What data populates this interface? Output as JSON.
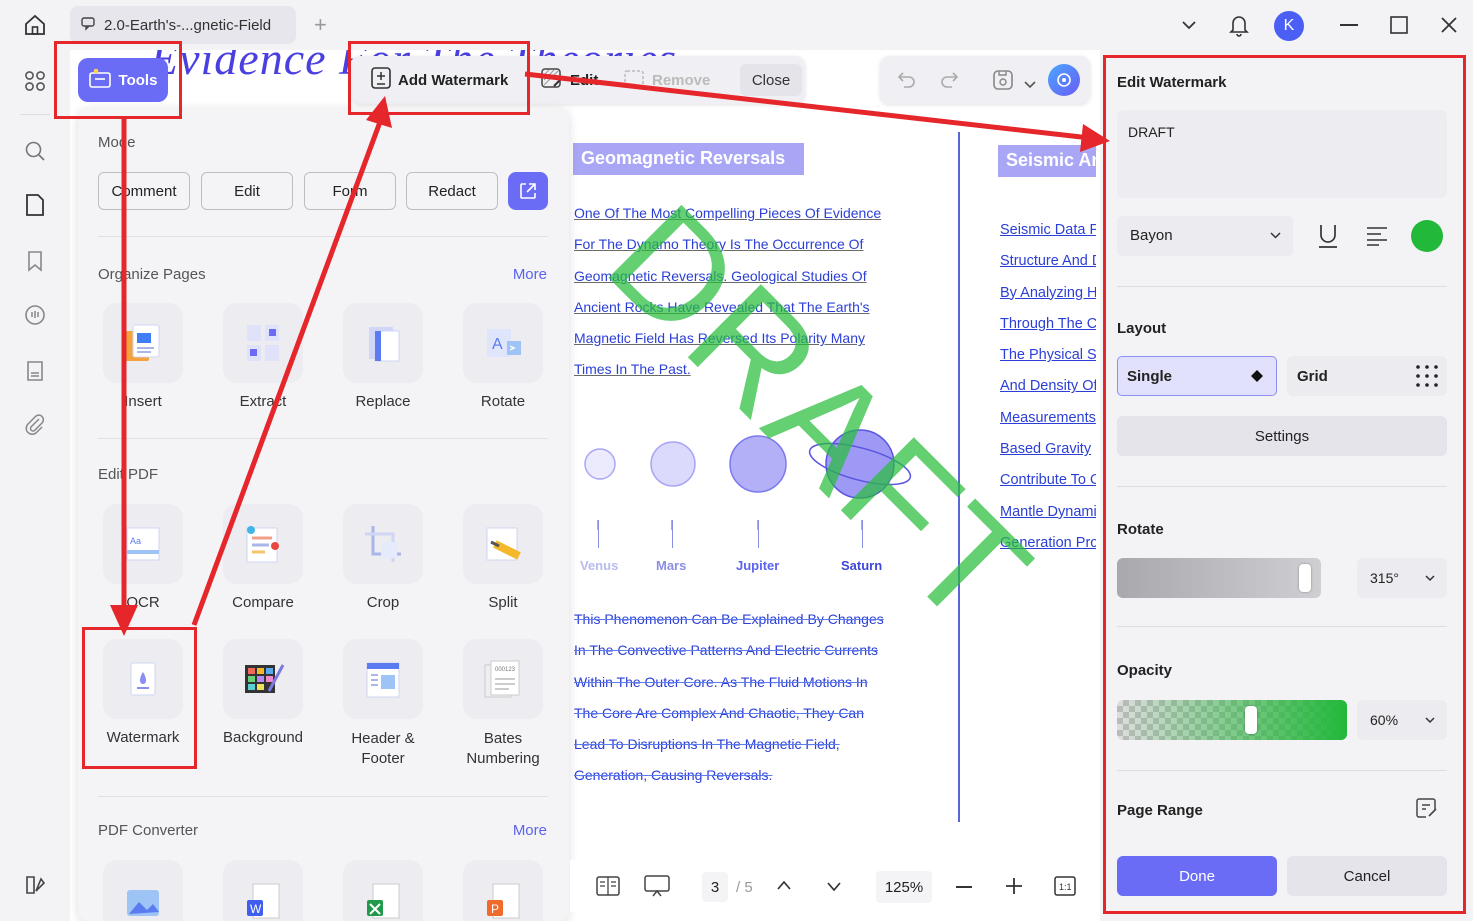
{
  "window": {
    "tab_title": "2.0-Earth's-...gnetic-Field",
    "avatar_letter": "K"
  },
  "toolbar": {
    "tools_label": "Tools",
    "add_watermark_label": "Add Watermark",
    "edit_label": "Edit",
    "remove_label": "Remove",
    "close_label": "Close"
  },
  "tools_panel": {
    "mode_heading": "Mode",
    "modes": [
      "Comment",
      "Edit",
      "Form",
      "Redact"
    ],
    "organize_heading": "Organize Pages",
    "organize_more": "More",
    "organize_items": [
      "Insert",
      "Extract",
      "Replace",
      "Rotate"
    ],
    "edit_pdf_heading": "Edit PDF",
    "edit_items": [
      "OCR",
      "Compare",
      "Crop",
      "Split",
      "Watermark",
      "Background",
      "Header & Footer",
      "Bates Numbering"
    ],
    "converter_heading": "PDF Converter",
    "converter_more": "More"
  },
  "document": {
    "title_fragment": "Evidence For The Theories",
    "section1": "Geomagnetic Reversals",
    "section2": "Seismic Analysis",
    "para1": [
      "One Of The Most Compelling Pieces Of Evidence",
      "For The Dynamo Theory Is The Occurrence Of",
      "Geomagnetic Reversals. Geological Studies Of",
      "Ancient Rocks Have Revealed That The Earth's",
      "Magnetic Field Has Reversed Its Polarity Many",
      "Times In The Past."
    ],
    "planets": [
      "Venus",
      "Mars",
      "Jupiter",
      "Saturn"
    ],
    "para2": [
      "This Phenomenon Can Be Explained By Changes",
      "In The Convective Patterns And Electric Currents",
      "Within The Outer Core. As The Fluid Motions In",
      "The Core Are Complex And Chaotic, They Can",
      "Lead To Disruptions In The Magnetic Field,",
      "Generation, Causing Reversals."
    ],
    "right_links": [
      "Seismic Data Provides",
      "Structure And Dynamics",
      "By Analyzing How",
      "Through The Core",
      "The Physical State",
      "And Density Of",
      "Measurements",
      "Based Gravity",
      "Contribute To Our",
      "Mantle Dynamics",
      "Generation Process"
    ],
    "watermark_preview": "DRAFT"
  },
  "bottom_bar": {
    "page_current": "3",
    "page_total": "/ 5",
    "zoom": "125%"
  },
  "edit_watermark": {
    "heading": "Edit Watermark",
    "text_value": "DRAFT",
    "font": "Bayon",
    "color": "#22b83a",
    "layout_heading": "Layout",
    "layout_single": "Single",
    "layout_grid": "Grid",
    "settings_label": "Settings",
    "rotate_heading": "Rotate",
    "rotate_value": "315°",
    "opacity_heading": "Opacity",
    "opacity_value": "60%",
    "page_range_heading": "Page Range",
    "done_label": "Done",
    "cancel_label": "Cancel"
  }
}
